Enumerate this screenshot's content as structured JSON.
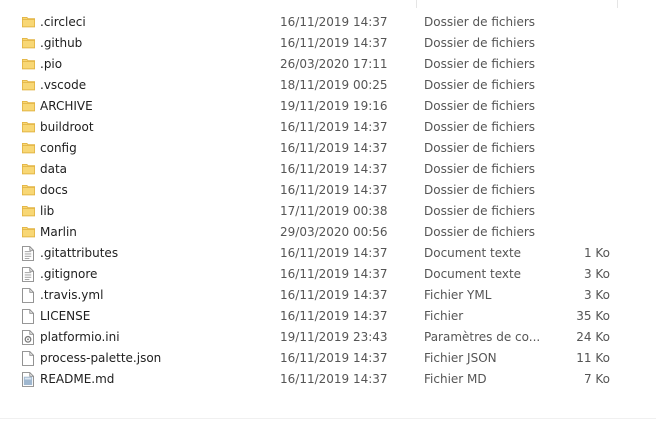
{
  "files": [
    {
      "name": ".circleci",
      "date": "16/11/2019 14:37",
      "type": "Dossier de fichiers",
      "size": "",
      "icon": "folder-icon"
    },
    {
      "name": ".github",
      "date": "16/11/2019 14:37",
      "type": "Dossier de fichiers",
      "size": "",
      "icon": "folder-icon"
    },
    {
      "name": ".pio",
      "date": "26/03/2020 17:11",
      "type": "Dossier de fichiers",
      "size": "",
      "icon": "folder-icon"
    },
    {
      "name": ".vscode",
      "date": "18/11/2019 00:25",
      "type": "Dossier de fichiers",
      "size": "",
      "icon": "folder-icon"
    },
    {
      "name": "ARCHIVE",
      "date": "19/11/2019 19:16",
      "type": "Dossier de fichiers",
      "size": "",
      "icon": "folder-icon"
    },
    {
      "name": "buildroot",
      "date": "16/11/2019 14:37",
      "type": "Dossier de fichiers",
      "size": "",
      "icon": "folder-icon"
    },
    {
      "name": "config",
      "date": "16/11/2019 14:37",
      "type": "Dossier de fichiers",
      "size": "",
      "icon": "folder-icon"
    },
    {
      "name": "data",
      "date": "16/11/2019 14:37",
      "type": "Dossier de fichiers",
      "size": "",
      "icon": "folder-icon"
    },
    {
      "name": "docs",
      "date": "16/11/2019 14:37",
      "type": "Dossier de fichiers",
      "size": "",
      "icon": "folder-icon"
    },
    {
      "name": "lib",
      "date": "17/11/2019 00:38",
      "type": "Dossier de fichiers",
      "size": "",
      "icon": "folder-icon"
    },
    {
      "name": "Marlin",
      "date": "29/03/2020 00:56",
      "type": "Dossier de fichiers",
      "size": "",
      "icon": "folder-icon"
    },
    {
      "name": ".gitattributes",
      "date": "16/11/2019 14:37",
      "type": "Document texte",
      "size": "1 Ko",
      "icon": "text-file-icon"
    },
    {
      "name": ".gitignore",
      "date": "16/11/2019 14:37",
      "type": "Document texte",
      "size": "3 Ko",
      "icon": "text-file-icon"
    },
    {
      "name": ".travis.yml",
      "date": "16/11/2019 14:37",
      "type": "Fichier YML",
      "size": "3 Ko",
      "icon": "blank-file-icon"
    },
    {
      "name": "LICENSE",
      "date": "16/11/2019 14:37",
      "type": "Fichier",
      "size": "35 Ko",
      "icon": "blank-file-icon"
    },
    {
      "name": "platformio.ini",
      "date": "19/11/2019 23:43",
      "type": "Paramètres de co...",
      "size": "24 Ko",
      "icon": "settings-file-icon"
    },
    {
      "name": "process-palette.json",
      "date": "16/11/2019 14:37",
      "type": "Fichier JSON",
      "size": "11 Ko",
      "icon": "blank-file-icon"
    },
    {
      "name": "README.md",
      "date": "16/11/2019 14:37",
      "type": "Fichier MD",
      "size": "7 Ko",
      "icon": "markdown-file-icon"
    }
  ],
  "colors": {
    "folder": "#f8d775",
    "folder_dark": "#e2b443",
    "file_border": "#8a8a8a"
  }
}
